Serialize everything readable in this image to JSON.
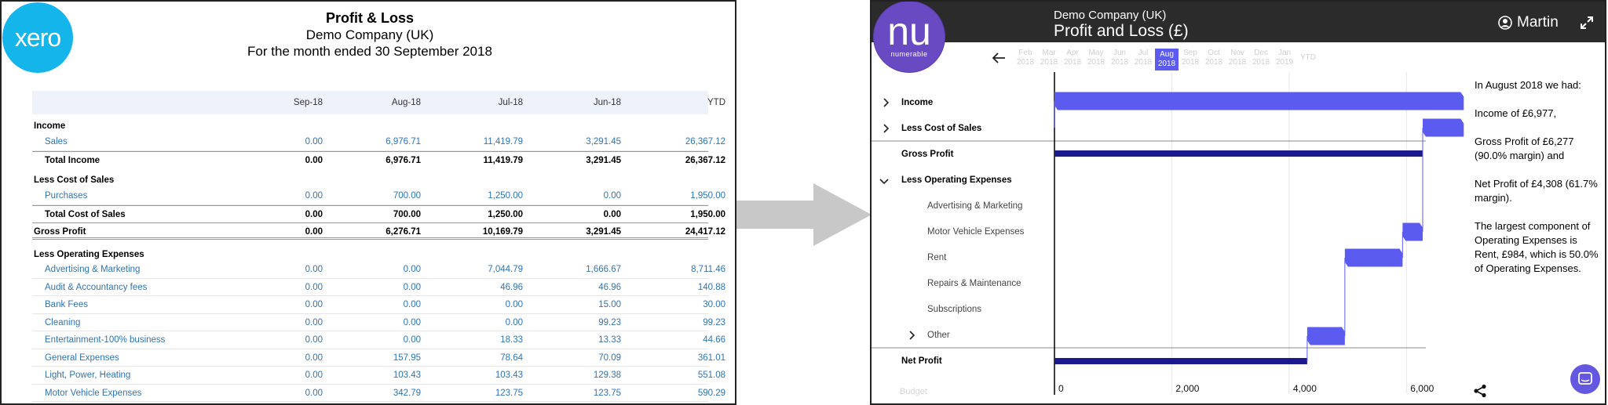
{
  "xero": {
    "logo": "xero",
    "title": "Profit & Loss",
    "company": "Demo Company (UK)",
    "period": "For the month ended 30 September 2018",
    "columns": [
      "Sep-18",
      "Aug-18",
      "Jul-18",
      "Jun-18",
      "YTD"
    ],
    "sections": [
      {
        "name": "Income",
        "items": [
          {
            "label": "Sales",
            "values": [
              "0.00",
              "6,976.71",
              "11,419.79",
              "3,291.45",
              "26,367.12"
            ]
          }
        ],
        "total": {
          "label": "Total Income",
          "values": [
            "0.00",
            "6,976.71",
            "11,419.79",
            "3,291.45",
            "26,367.12"
          ]
        }
      },
      {
        "name": "Less Cost of Sales",
        "items": [
          {
            "label": "Purchases",
            "values": [
              "0.00",
              "700.00",
              "1,250.00",
              "0.00",
              "1,950.00"
            ]
          }
        ],
        "total": {
          "label": "Total Cost of Sales",
          "values": [
            "0.00",
            "700.00",
            "1,250.00",
            "0.00",
            "1,950.00"
          ]
        }
      }
    ],
    "gross_profit": {
      "label": "Gross Profit",
      "values": [
        "0.00",
        "6,276.71",
        "10,169.79",
        "3,291.45",
        "24,417.12"
      ]
    },
    "opex_title": "Less Operating Expenses",
    "opex_items": [
      {
        "label": "Advertising & Marketing",
        "values": [
          "0.00",
          "0.00",
          "7,044.79",
          "1,666.67",
          "8,711.46"
        ]
      },
      {
        "label": "Audit & Accountancy fees",
        "values": [
          "0.00",
          "0.00",
          "46.96",
          "46.96",
          "140.88"
        ]
      },
      {
        "label": "Bank Fees",
        "values": [
          "0.00",
          "0.00",
          "0.00",
          "15.00",
          "30.00"
        ]
      },
      {
        "label": "Cleaning",
        "values": [
          "0.00",
          "0.00",
          "0.00",
          "99.23",
          "99.23"
        ]
      },
      {
        "label": "Entertainment-100% business",
        "values": [
          "0.00",
          "0.00",
          "18.33",
          "13.33",
          "44.66"
        ]
      },
      {
        "label": "General Expenses",
        "values": [
          "0.00",
          "157.95",
          "78.64",
          "70.09",
          "361.01"
        ]
      },
      {
        "label": "Light, Power, Heating",
        "values": [
          "0.00",
          "103.43",
          "103.43",
          "129.38",
          "551.08"
        ]
      },
      {
        "label": "Motor Vehicle Expenses",
        "values": [
          "0.00",
          "342.79",
          "123.75",
          "123.75",
          "590.29"
        ]
      }
    ]
  },
  "numerable": {
    "company": "Demo Company (UK)",
    "title": "Profit and Loss (£)",
    "user": "Martin",
    "logo_mark": "nu",
    "logo_name": "numerable",
    "months": [
      {
        "m": "Feb",
        "y": "2018"
      },
      {
        "m": "Mar",
        "y": "2018"
      },
      {
        "m": "Apr",
        "y": "2018"
      },
      {
        "m": "May",
        "y": "2018"
      },
      {
        "m": "Jun",
        "y": "2018"
      },
      {
        "m": "Jul",
        "y": "2018"
      },
      {
        "m": "Aug",
        "y": "2018"
      },
      {
        "m": "Sep",
        "y": "2018"
      },
      {
        "m": "Oct",
        "y": "2018"
      },
      {
        "m": "Nov",
        "y": "2018"
      },
      {
        "m": "Dec",
        "y": "2018"
      },
      {
        "m": "Jan",
        "y": "2019"
      }
    ],
    "selected_month": 6,
    "ytd_label": "YTD",
    "rows": {
      "income": "Income",
      "cost_of_sales": "Less Cost of Sales",
      "gross_profit": "Gross Profit",
      "opex": "Less Operating Expenses",
      "advertising": "Advertising & Marketing",
      "motor": "Motor Vehicle Expenses",
      "rent": "Rent",
      "repairs": "Repairs & Maintenance",
      "subscriptions": "Subscriptions",
      "other": "Other",
      "net_profit": "Net Profit"
    },
    "budget_label": "Budget",
    "summary": [
      "In August 2018 we had:",
      "Income of £6,977,",
      "Gross Profit of £6,277 (90.0% margin) and",
      "Net Profit of £4,308 (61.7% margin).",
      "The largest component of Operating Expenses is Rent, £984, which is 50.0% of Operating Expenses."
    ],
    "colors": {
      "bar": "#5b5bf0",
      "total_bar": "#1a1a8c",
      "header": "#2b2b2b",
      "logo": "#6a4ac2"
    }
  },
  "chart_data": {
    "type": "bar",
    "title": "",
    "xlabel": "",
    "ylabel": "",
    "xlim": [
      0,
      7000
    ],
    "x_ticks": [
      "0",
      "2,000",
      "4,000",
      "6,000"
    ],
    "categories": [
      "Income",
      "Less Cost of Sales",
      "Gross Profit",
      "Advertising & Marketing",
      "Motor Vehicle Expenses",
      "Rent",
      "Repairs & Maintenance",
      "Subscriptions",
      "Other",
      "Net Profit"
    ],
    "bars": [
      {
        "label": "Income",
        "start": 0,
        "end": 6977,
        "kind": "step"
      },
      {
        "label": "Less Cost of Sales",
        "start": 6277,
        "end": 6977,
        "kind": "step"
      },
      {
        "label": "Gross Profit",
        "start": 0,
        "end": 6277,
        "kind": "total"
      },
      {
        "label": "Advertising & Marketing",
        "start": 6277,
        "end": 6277,
        "kind": "step"
      },
      {
        "label": "Motor Vehicle Expenses",
        "start": 5934,
        "end": 6277,
        "kind": "step"
      },
      {
        "label": "Rent",
        "start": 4950,
        "end": 5934,
        "kind": "step"
      },
      {
        "label": "Repairs & Maintenance",
        "start": 4950,
        "end": 4950,
        "kind": "step"
      },
      {
        "label": "Subscriptions",
        "start": 4950,
        "end": 4950,
        "kind": "step"
      },
      {
        "label": "Other",
        "start": 4308,
        "end": 4950,
        "kind": "step"
      },
      {
        "label": "Net Profit",
        "start": 0,
        "end": 4308,
        "kind": "total"
      }
    ]
  }
}
